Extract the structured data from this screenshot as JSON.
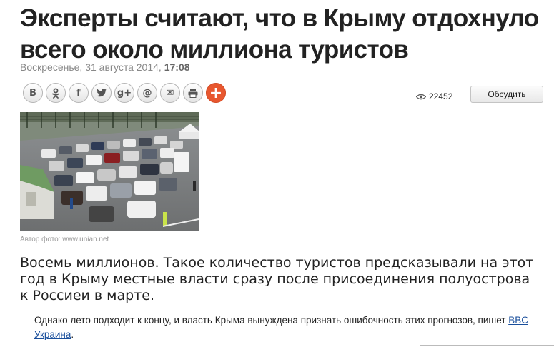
{
  "article": {
    "headline": "Эксперты считают, что в Крыму отдохнуло всего около миллиона туристов",
    "date": "Воскресенье, 31 августа 2014,",
    "time": "17:08",
    "views": "22452",
    "discuss_label": "Обсудить",
    "photo_caption": "Автор фото: www.unian.net",
    "lead": "Восемь миллионов. Такое количество туристов предсказывали на этот год в Крыму местные власти сразу после присоединения полуострова к Россиеи в марте.",
    "body_prefix": "Однако лето подходит к концу, и власть Крыма вынуждена признать ошибочность этих прогнозов, пишет ",
    "body_link": "BBC Украина",
    "body_suffix": "."
  },
  "share": {
    "vk": "В",
    "ok": "ок",
    "fb": "f",
    "tw": "tw",
    "gplus": "g+",
    "mail": "@",
    "email": "✉",
    "print": "⎙",
    "more": "+"
  },
  "icons": {
    "views": "eye-icon",
    "accent": "#e8572f"
  }
}
